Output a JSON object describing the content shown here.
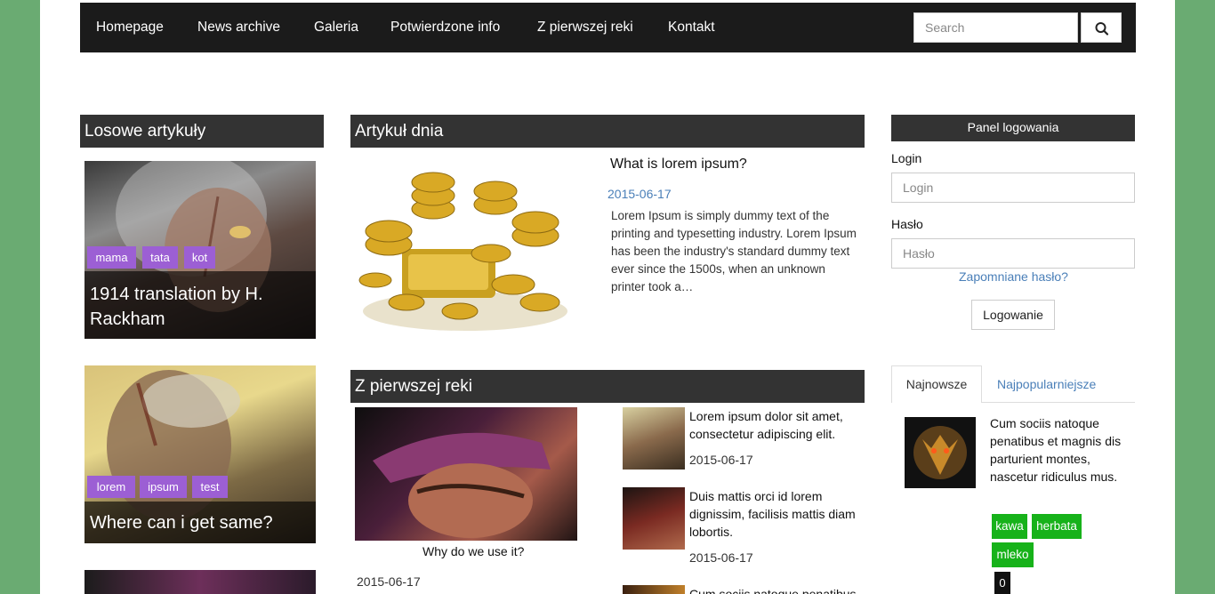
{
  "nav": {
    "items": [
      "Homepage",
      "News archive",
      "Galeria",
      "Potwierdzone info",
      "Z pierwszej reki",
      "Kontakt"
    ],
    "search_placeholder": "Search"
  },
  "random_articles": {
    "title": "Losowe artykuły",
    "items": [
      {
        "tags": [
          "mama",
          "tata",
          "kot"
        ],
        "title": "1914 translation by H. Rackham"
      },
      {
        "tags": [
          "lorem",
          "ipsum",
          "test"
        ],
        "title": "Where can i get same?"
      }
    ]
  },
  "article_of_day": {
    "title": "Artykuł dnia",
    "headline": "What is lorem ipsum?",
    "date": "2015-06-17",
    "excerpt": "Lorem Ipsum is simply dummy text of the printing and typesetting industry. Lorem Ipsum has been the industry's standard dummy text ever since the 1500s, when an unknown printer took a…"
  },
  "first_hand": {
    "title": "Z pierwszej reki",
    "main": {
      "caption": "Why do we use it?",
      "date": "2015-06-17"
    },
    "list": [
      {
        "title": "Lorem ipsum dolor sit amet, consectetur adipiscing elit.",
        "date": "2015-06-17"
      },
      {
        "title": "Duis mattis orci id lorem dignissim, facilisis mattis diam lobortis.",
        "date": "2015-06-17"
      },
      {
        "title": "Cum sociis natoque penatibus",
        "date": ""
      }
    ]
  },
  "login": {
    "title": "Panel logowania",
    "login_label": "Login",
    "login_placeholder": "Login",
    "password_label": "Hasło",
    "password_placeholder": "Hasło",
    "forgot": "Zapomniane hasło?",
    "submit": "Logowanie"
  },
  "tabs": {
    "newest": "Najnowsze",
    "popular": "Najpopularniejsze",
    "entry": {
      "text": "Cum sociis natoque penatibus et magnis dis parturient montes, nascetur ridiculus mus."
    },
    "tags": [
      "kawa",
      "herbata",
      "mleko"
    ],
    "count": "0"
  },
  "colors": {
    "accent_tag": "#9c5fd4",
    "green_tag": "#17b21a",
    "header": "#333333",
    "link": "#4a7fb8"
  }
}
